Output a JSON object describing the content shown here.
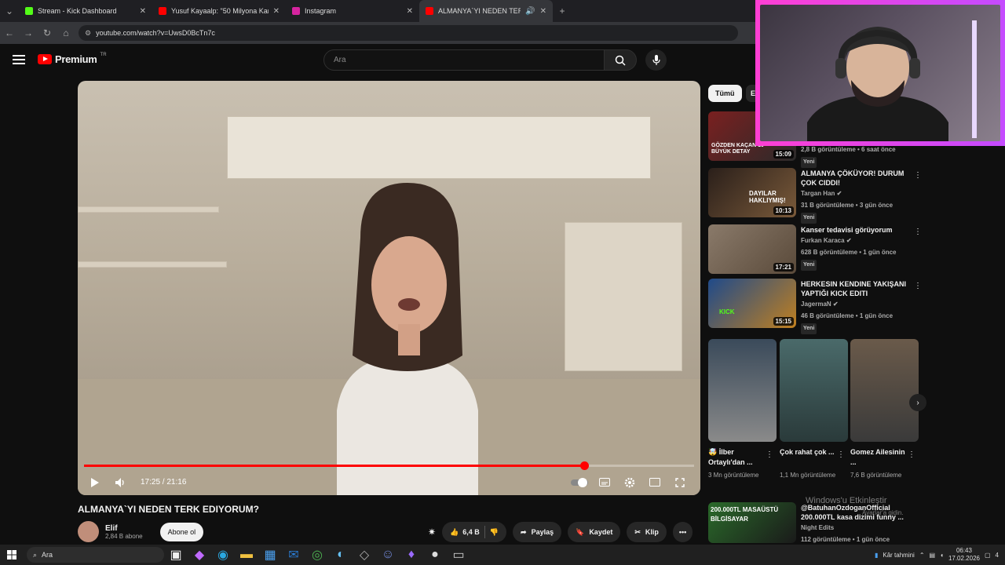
{
  "browser": {
    "tabs": [
      {
        "title": "Stream - Kick Dashboard",
        "color": "#53fc18"
      },
      {
        "title": "Yusuf Kayaalp: \"50 Milyona Kar...",
        "color": "#ff0000"
      },
      {
        "title": "Instagram",
        "color": "#d6249f"
      },
      {
        "title": "ALMANYA`YI NEDEN TERK E...",
        "color": "#ff0000"
      }
    ],
    "url": "youtube.com/watch?v=UwsD0BcTn7c"
  },
  "header": {
    "logo": "Premium",
    "region": "TR",
    "search_placeholder": "Ara"
  },
  "player": {
    "time": "17:25 / 21:16",
    "progress": 0.82
  },
  "video": {
    "title": "ALMANYA`YI NEDEN TERK EDIYORUM?",
    "channel": "Elif",
    "subscribers": "2,84 B abone",
    "subscribe_label": "Abone ol",
    "likes": "6,4 B",
    "share_label": "Paylaş",
    "save_label": "Kaydet",
    "clip_label": "Klip"
  },
  "sidebar": {
    "chips": [
      "Tümü",
      "Elif"
    ],
    "recs": [
      {
        "title": "",
        "channel": "",
        "meta": "2,8 B görüntüleme • 6 saat önce",
        "new": "Yeni",
        "duration": "15:09",
        "thumb_text": "GÖZDEN KAÇAN 10 BÜYÜK DETAY",
        "thumb_color": "#6b1f1f"
      },
      {
        "title": "ALMANYA ÇÖKÜYOR! DURUM ÇOK CIDDI!",
        "channel": "Targan Han",
        "meta": "31 B görüntüleme • 3 gün önce",
        "new": "Yeni",
        "duration": "10:13",
        "thumb_text": "DAYILAR HAKLIYMIŞ!",
        "thumb_color": "#3b2a24"
      },
      {
        "title": "Kanser tedavisi görüyorum",
        "channel": "Furkan Karaca",
        "meta": "628 B görüntüleme • 1 gün önce",
        "new": "Yeni",
        "duration": "17:21",
        "thumb_text": "",
        "thumb_color": "#7a6a5a"
      },
      {
        "title": "HERKESIN KENDINE YAKIŞANI YAPTIĞI KICK EDITI",
        "channel": "JagermaN",
        "meta": "46 B görüntüleme • 1 gün önce",
        "new": "Yeni",
        "duration": "15:15",
        "thumb_text": "KICK",
        "thumb_color": "#1f4a8a"
      }
    ],
    "shorts": [
      {
        "title": "🤯 İlber Ortaylı'dan ...",
        "views": "3 Mn görüntüleme",
        "color": "#3a4a5a"
      },
      {
        "title": "Çok rahat çok ...",
        "views": "1,1 Mn görüntüleme",
        "color": "#4a6a6a"
      },
      {
        "title": "Gomez Ailesinin ...",
        "views": "7,6 B görüntüleme",
        "color": "#5a4a3a"
      }
    ],
    "last_rec": {
      "title": "@BatuhanOzdoganOfficial 200.000TL kasa dizimi funny ...",
      "channel": "Night Edits",
      "meta": "112 görüntüleme • 1 gün önce",
      "thumb_text": "200.000TL MASAÜSTÜ BİLGİSAYAR"
    }
  },
  "watermark": {
    "line1": "Windows'u Etkinleştir",
    "line2": "Ayarlar'a gidin."
  },
  "taskbar": {
    "search": "Ara",
    "weather": "Kâr tahmini",
    "time": "06:43",
    "date": "17.02.2026",
    "notif": "4"
  }
}
